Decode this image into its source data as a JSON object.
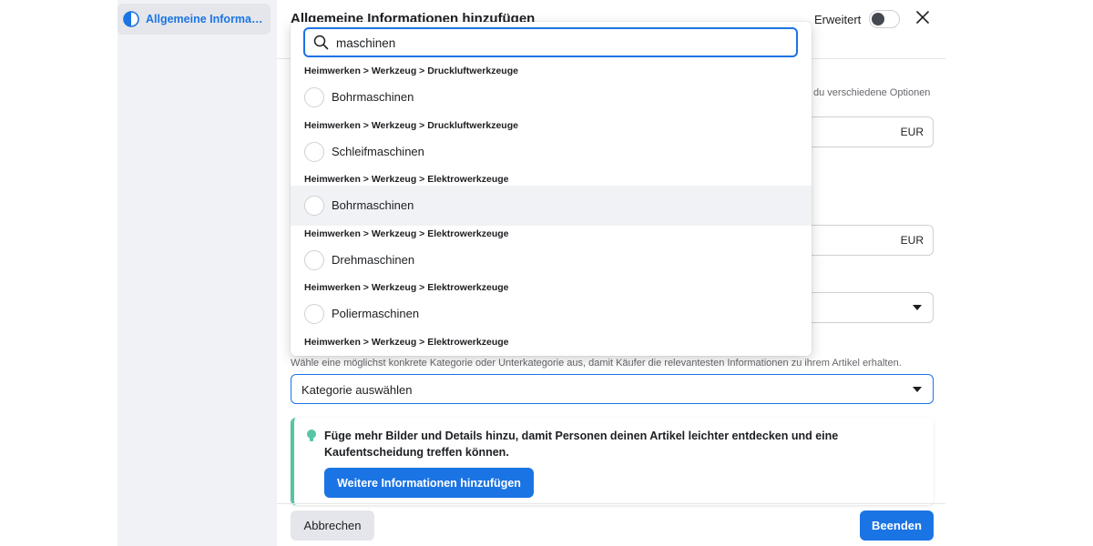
{
  "sidebar": {
    "item_label": "Allgemeine Informat…"
  },
  "modal": {
    "title": "Allgemeine Informationen hinzufügen",
    "advanced_label": "Erweitert",
    "advanced_toggle_on": false
  },
  "background_form": {
    "options_hint": "du verschiedene Optionen",
    "price_currency_1": "EUR",
    "price_currency_2": "EUR"
  },
  "category": {
    "helper_text": "Wähle eine möglichst konkrete Kategorie oder Unterkategorie aus, damit Käufer die relevantesten Informationen zu ihrem Artikel erhalten.",
    "select_placeholder": "Kategorie auswählen"
  },
  "tip": {
    "text": "Füge mehr Bilder und Details hinzu, damit Personen deinen Artikel leichter entdecken und eine Kaufentscheidung treffen können.",
    "button_label": "Weitere Informationen hinzufügen"
  },
  "footer": {
    "cancel_label": "Abbrechen",
    "finish_label": "Beenden"
  },
  "dropdown": {
    "search_value": "maschinen",
    "results": [
      {
        "path": "Heimwerken > Werkzeug > Druckluftwerkzeuge",
        "label": "Bohrmaschinen"
      },
      {
        "path": "Heimwerken > Werkzeug > Druckluftwerkzeuge",
        "label": "Schleifmaschinen"
      },
      {
        "path": "Heimwerken > Werkzeug > Elektrowerkzeuge",
        "label": "Bohrmaschinen"
      },
      {
        "path": "Heimwerken > Werkzeug > Elektrowerkzeuge",
        "label": "Drehmaschinen"
      },
      {
        "path": "Heimwerken > Werkzeug > Elektrowerkzeuge",
        "label": "Poliermaschinen"
      },
      {
        "path": "Heimwerken > Werkzeug > Elektrowerkzeuge",
        "label": ""
      }
    ],
    "hovered_index": 2
  },
  "colors": {
    "accent": "#1b74e4",
    "tip_accent": "#57c4a4"
  }
}
